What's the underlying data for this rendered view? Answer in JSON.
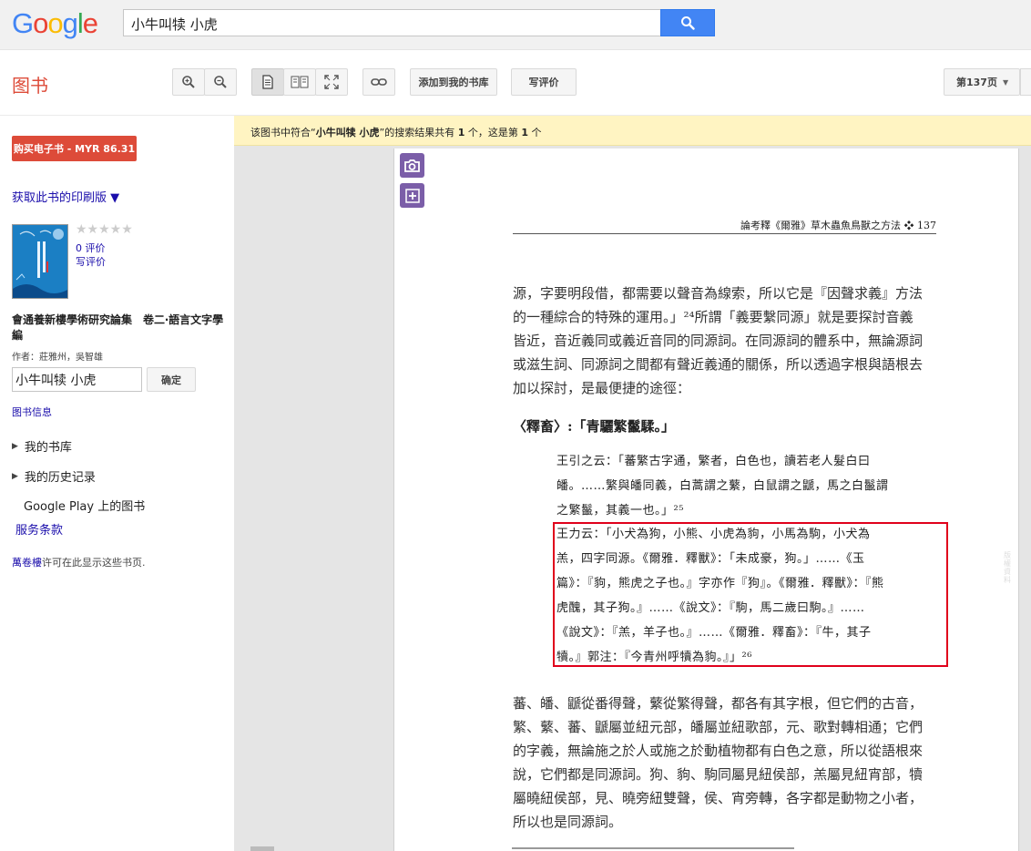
{
  "header": {
    "logo_letters": [
      "G",
      "o",
      "o",
      "g",
      "l",
      "e"
    ],
    "logo_colors": [
      "#4285f4",
      "#ea4335",
      "#fbbc05",
      "#4285f4",
      "#34a853",
      "#ea4335"
    ],
    "search_value": "小牛叫犊 小虎",
    "search_icon": "search-icon"
  },
  "toolbar": {
    "section_title": "图书",
    "zoom_in_icon": "zoom-in-icon",
    "zoom_out_icon": "zoom-out-icon",
    "single_page_icon": "single-page-icon",
    "two_page_icon": "two-page-icon",
    "fullscreen_icon": "fullscreen-icon",
    "link_icon": "link-icon",
    "add_library_label": "添加到我的书库",
    "write_review_label": "写评价",
    "page_select_label": "第137页"
  },
  "sidebar": {
    "buy_label": "购买电子书 - MYR 86.31",
    "print_link": "获取此书的印刷版 ▼",
    "stars": "★★★★★",
    "reviews_count": "0 评价",
    "write_review": "写评价",
    "book_name": "會通養新樓學術研究論集　卷二‧語言文字學編",
    "authors": "作者：莊雅州，吳智雄",
    "inbook_search_value": "小牛叫犊 小虎",
    "inbook_search_button": "确定",
    "book_info": "图书信息",
    "nav": [
      "我的书库",
      "我的历史记录"
    ],
    "play_books": "Google Play 上的图书",
    "terms": "服务条款",
    "permission_publisher": "萬卷樓",
    "permission_text": "许可在此显示这些书页."
  },
  "viewer": {
    "notice_prefix": "该图书中符合“",
    "notice_query": "小牛叫犊 小虎",
    "notice_mid": "”的搜索结果共有 ",
    "notice_count": "1",
    "notice_mid2": " 个，这是第 ",
    "notice_index": "1",
    "notice_suffix": " 个",
    "camera_icon": "camera-icon",
    "add_icon": "plus-icon"
  },
  "page": {
    "running_head": "論考釋《爾雅》草木蟲魚鳥獸之方法 ❖ 137",
    "para1_lines": [
      "源，字要明段借，都需要以聲音為線索，所以它是『因聲求義』方法",
      "的一種綜合的特殊的運用。」²⁴所謂「義要繫同源」就是要探討音義",
      "皆近，音近義同或義近音同的同源詞。在同源詞的體系中，無論源詞",
      "或滋生詞、同源詞之間都有聲近義通的關係，所以透過字根與語根去",
      "加以探討，是最便捷的途徑："
    ],
    "heading": "〈釋畜〉:「青驪繁鬣騥。」",
    "quote1_lines": [
      "王引之云：「蕃繁古字通，繁者，白色也，讀若老人髮白曰",
      "皤。……繁與皤同義，白蒿謂之蘩，白鼠謂之鼶，馬之白鬣謂",
      "之繁鬣，其義一也。」²⁵"
    ],
    "quote2_lines": [
      "王力云：「小犬為狗，小熊、小虎為豿，小馬為駒，小犬為",
      "羔，四字同源。《爾雅．釋獸》：「未成豪，狗。」……《玉",
      "篇》：『豿，熊虎之子也。』字亦作『狗』。《爾雅．釋獸》：『熊",
      "虎醜，其子狗。』……《說文》：『駒，馬二歲曰駒。』……",
      "《說文》：『羔，羊子也。』……《爾雅．釋畜》：『牛，其子",
      "犢。』郭注：『今青州呼犢為豿。』」²⁶"
    ],
    "para2_lines": [
      "蕃、皤、鼶從番得聲，蘩從繁得聲，都各有其字根，但它們的古音，",
      "繁、蘩、蕃、鼶屬並紐元部，皤屬並紐歌部，元、歌對轉相通；它們",
      "的字義，無論施之於人或施之於動植物都有白色之意，所以從語根來",
      "說，它們都是同源詞。狗、豿、駒同屬見紐侯部，羔屬見紐宵部，犢",
      "屬曉紐侯部，見、曉旁紐雙聲，侯、宵旁轉，各字都是動物之小者，",
      "所以也是同源詞。"
    ],
    "side_watermark": "版權資料"
  }
}
